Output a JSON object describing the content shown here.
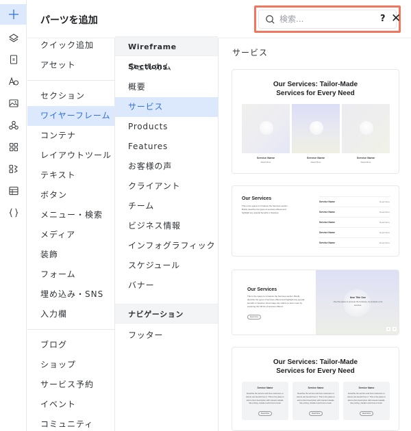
{
  "header": {
    "title": "パーツを追加",
    "search_placeholder": "検索...",
    "help_label": "?",
    "close_label": "✕"
  },
  "rail": {
    "items": [
      {
        "icon": "plus-icon",
        "active": true
      },
      {
        "icon": "layers-icon"
      },
      {
        "icon": "page-icon"
      },
      {
        "icon": "text-theme-icon"
      },
      {
        "icon": "image-icon"
      },
      {
        "icon": "apps-icon"
      },
      {
        "icon": "grid-icon"
      },
      {
        "icon": "integrations-icon"
      },
      {
        "icon": "table-icon"
      },
      {
        "icon": "code-braces-icon"
      }
    ]
  },
  "categories": {
    "group1": [
      "クイック追加",
      "アセット"
    ],
    "group2": [
      "セクション",
      "ワイヤーフレーム",
      "コンテナ",
      "レイアウトツール",
      "テキスト",
      "ボタン",
      "メニュー・検索",
      "メディア",
      "装飾",
      "フォーム",
      "埋め込み・SNS",
      "入力欄"
    ],
    "group3": [
      "ブログ",
      "ショップ",
      "サービス予約",
      "イベント",
      "コミュニティ"
    ],
    "active": "ワイヤーフレーム"
  },
  "sections": {
    "head1": "Wireframe Sections",
    "items1": [
      "ウェルカム",
      "概要",
      "サービス",
      "Products",
      "Features",
      "お客様の声",
      "クライアント",
      "チーム",
      "ビジネス情報",
      "インフォグラフィック",
      "スケジュール",
      "バナー"
    ],
    "head2": "ナビゲーション",
    "items2": [
      "フッター"
    ],
    "active": "サービス"
  },
  "preview": {
    "title": "サービス",
    "card1": {
      "title_line1": "Our Services: Tailor-Made",
      "title_line2": "Services for Every Need",
      "tiles": [
        {
          "name": "Service Name",
          "sub": "Read More"
        },
        {
          "name": "Service Name",
          "sub": "Read More"
        },
        {
          "name": "Service Name",
          "sub": "Read More"
        }
      ]
    },
    "card2": {
      "title": "Our Services",
      "desc": "This is the space to introduce the Services section. Briefly describe the types of services offered and highlight any special benefits or features.",
      "rows": [
        {
          "name": "Service Name",
          "link": "Read More"
        },
        {
          "name": "Service Name",
          "link": "Read More"
        },
        {
          "name": "Service Name",
          "link": "Read More"
        },
        {
          "name": "Service Name",
          "link": "Read More"
        },
        {
          "name": "Service Name",
          "link": "Read More"
        }
      ]
    },
    "card3": {
      "title": "Our Services",
      "desc": "This is the space to introduce the Services section. Briefly describe the types of services offered and highlight any special benefits or features. Encourage site visitors to learn more by exploring the full list of services offered.",
      "button": "Read More",
      "item_title": "Item Title One",
      "item_desc": "Use this space to promote the business, its products or its services.",
      "prev": "‹",
      "next": "›"
    },
    "card4": {
      "title_line1": "Our Services: Tailor-Made",
      "title_line2": "Services for Every Need",
      "boxes": [
        {
          "name": "Service Name",
          "desc": "Describe the service and how customers or clients can benefit from it. This is the place to add a short description with relevant details, like pricing, duration and how to book.",
          "button": "Read More"
        },
        {
          "name": "Service Name",
          "desc": "Describe the service and how customers or clients can benefit from it. This is the place to add a short description with relevant details, like pricing, duration and how to book.",
          "button": "Read More"
        },
        {
          "name": "Service Name",
          "desc": "Describe the service and how customers or clients can benefit from it. This is the place to add a short description with relevant details, like pricing, duration and how to book.",
          "button": "Read More"
        }
      ]
    }
  },
  "colors": {
    "accent": "#2f6fe0",
    "selected_bg": "#dce8fb",
    "search_highlight": "#f0765e"
  }
}
